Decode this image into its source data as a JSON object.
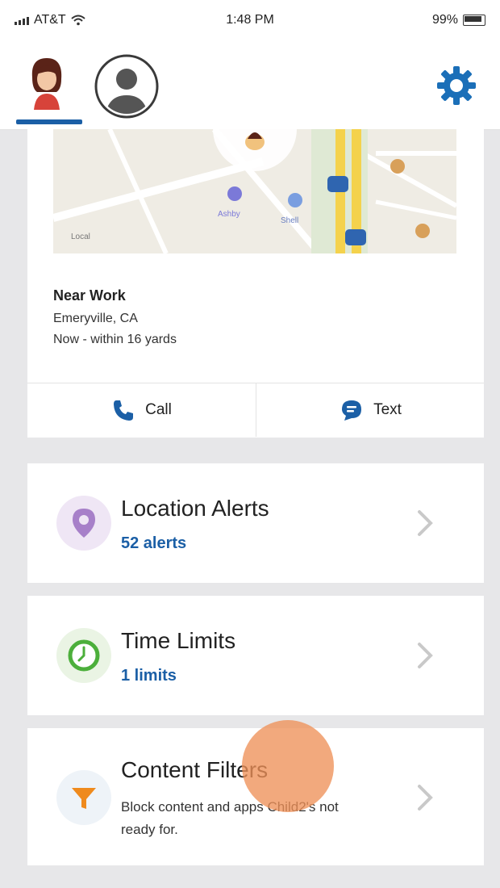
{
  "status_bar": {
    "carrier": "AT&T",
    "time": "1:48 PM",
    "battery": "99%"
  },
  "icons": {
    "child_avatar": "child-avatar",
    "parent_avatar": "person-icon",
    "settings": "gear-icon",
    "call": "phone-icon",
    "text": "chat-bubble-icon",
    "location": "location-pin-icon",
    "time": "clock-icon",
    "filter": "funnel-icon",
    "chevron": "chevron-right-icon"
  },
  "colors": {
    "accent": "#1b5fa6",
    "location_icon": "#a780c9",
    "time_icon": "#4caf3b",
    "filter_icon": "#ef8a1d",
    "touch_indicator": "#ee9158"
  },
  "location": {
    "title": "Near Work",
    "city": "Emeryville, CA",
    "time": "Now - within 16 yards",
    "map_labels": {
      "local": "Local",
      "map_label_1": "Ashby",
      "map_label_2": "Shell"
    }
  },
  "actions": {
    "call_label": "Call",
    "text_label": "Text"
  },
  "features": {
    "location_alerts": {
      "title": "Location Alerts",
      "subtitle": "52 alerts"
    },
    "time_limits": {
      "title": "Time Limits",
      "subtitle": "1 limits"
    },
    "content_filters": {
      "title": "Content Filters",
      "description": "Block content and apps Child2's not ready for."
    }
  }
}
